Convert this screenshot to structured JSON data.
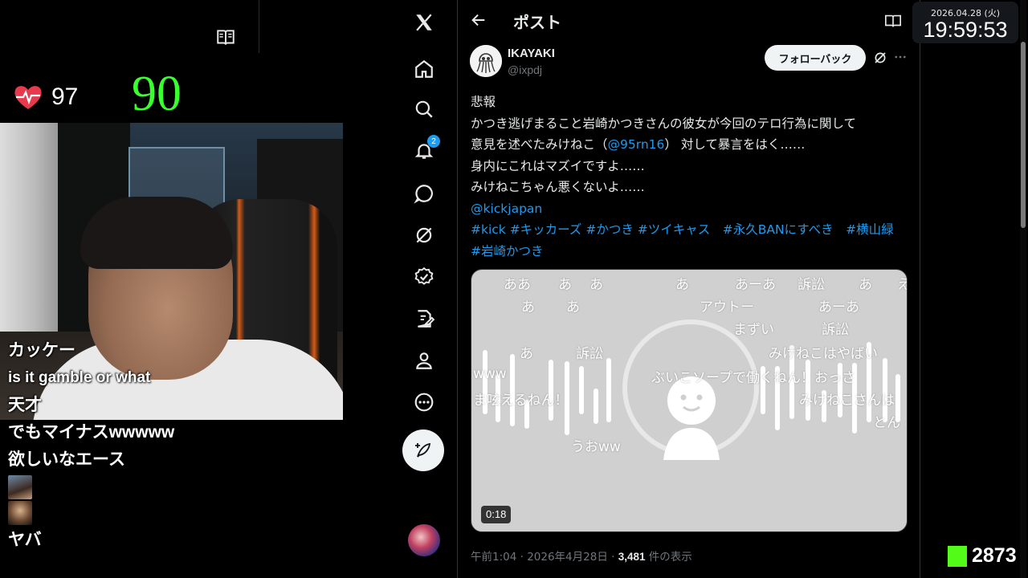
{
  "stream": {
    "heart_rate": "97",
    "big_number": "90",
    "chat": [
      "カッケー",
      "is it gamble or what",
      "天才",
      "でもマイナスwwwww",
      "欲しいなエース",
      "ヤバ"
    ],
    "colors": {
      "heart": "#e83a4d",
      "big_number": "#39ff2f"
    }
  },
  "nav": {
    "notification_count": "2",
    "icons": [
      "x-logo-icon",
      "home-icon",
      "search-icon",
      "bell-icon",
      "chat-icon",
      "grok-icon",
      "verified-icon",
      "edit-icon",
      "profile-icon",
      "more-icon",
      "compose-icon"
    ]
  },
  "post": {
    "header_title": "ポスト",
    "author_name": "IKAYAKI",
    "author_handle": "@ixpdj",
    "follow_label": "フォローバック",
    "body": {
      "line1": "悲報",
      "line2": "かつき逃げまること岩崎かつきさんの彼女が今回のテロ行為に関して",
      "line3_pre": "意見を述べたみけねこ（",
      "line3_mention": "@95rn16",
      "line3_post": "） 対して暴言をはく……",
      "line4": "身内にこれはマズイですよ……",
      "line5": "みけねこちゃん悪くないよ……",
      "mention2": "@kickjapan",
      "hashtags_line1": "#kick #キッカーズ #かつき #ツイキャス　#永久BANにすべき　#横山緑",
      "hashtags_line2": "#岩崎かつき"
    },
    "media": {
      "duration": "0:18",
      "danmaku": [
        "ああ",
        "あ",
        "あ",
        "あ",
        "あーあ",
        "訴訟",
        "あ",
        "え",
        "あ",
        "あ",
        "アウトー",
        "あーあ",
        "まずい",
        "訴訟",
        "あ",
        "訴訟",
        "みけねこはやばい",
        "www",
        "ぶいこソープで働くねん！おっさ",
        "ま呟えるねん！",
        "みけねこさんは",
        "とん",
        "うおww"
      ]
    },
    "meta": {
      "time_date": "午前1:04 · 2026年4月28日 · ",
      "views": "3,481",
      "views_suffix": " 件の表示"
    }
  },
  "overlay": {
    "date": "2026.04.28 (火)",
    "time": "19:59:53",
    "kick_viewers": "2873",
    "colors": {
      "kick": "#53fc18",
      "link": "#1d9bf0"
    }
  }
}
